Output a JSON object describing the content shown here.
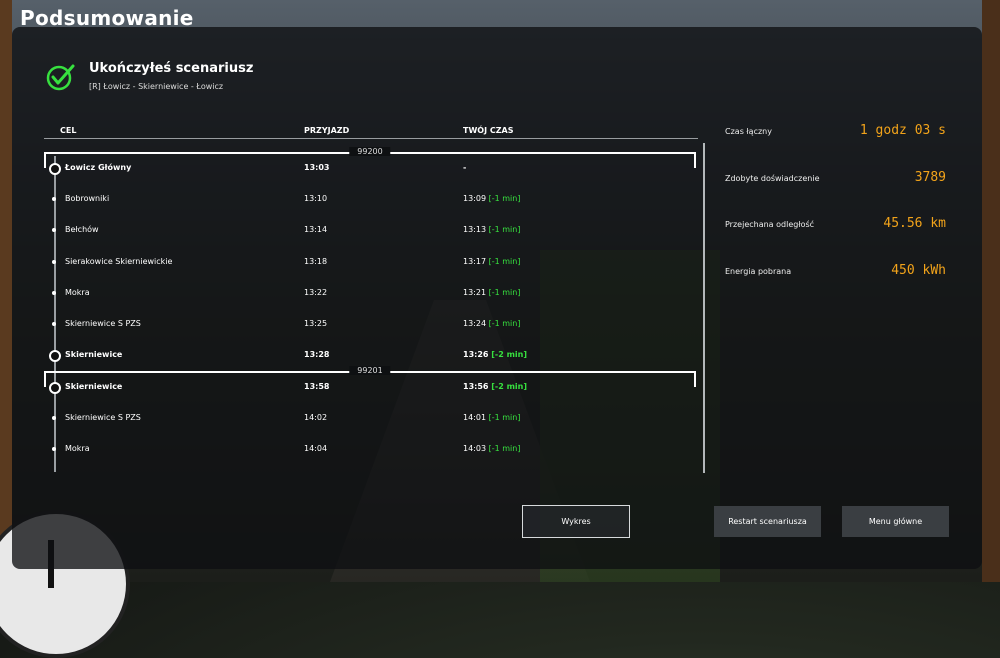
{
  "page_title": "Podsumowanie",
  "header": {
    "title": "Ukończyłeś scenariusz",
    "route": "[R] Łowicz - Skierniewice - Łowicz",
    "check_color": "#37e03f"
  },
  "table": {
    "headers": {
      "target": "CEL",
      "arrival": "PRZYJAZD",
      "your_time": "TWÓJ CZAS"
    },
    "groups": [
      {
        "train_number": "99200",
        "rows": [
          {
            "name": "Łowicz Główny",
            "arrival": "13:03",
            "time": "-",
            "delay": "",
            "major": true
          },
          {
            "name": "Bobrowniki",
            "arrival": "13:10",
            "time": "13:09",
            "delay": "[-1 min]",
            "major": false
          },
          {
            "name": "Bełchów",
            "arrival": "13:14",
            "time": "13:13",
            "delay": "[-1 min]",
            "major": false
          },
          {
            "name": "Sierakowice Skierniewickie",
            "arrival": "13:18",
            "time": "13:17",
            "delay": "[-1 min]",
            "major": false
          },
          {
            "name": "Mokra",
            "arrival": "13:22",
            "time": "13:21",
            "delay": "[-1 min]",
            "major": false
          },
          {
            "name": "Skierniewice S PZS",
            "arrival": "13:25",
            "time": "13:24",
            "delay": "[-1 min]",
            "major": false
          },
          {
            "name": "Skierniewice",
            "arrival": "13:28",
            "time": "13:26",
            "delay": "[-2 min]",
            "major": true
          }
        ]
      },
      {
        "train_number": "99201",
        "rows": [
          {
            "name": "Skierniewice",
            "arrival": "13:58",
            "time": "13:56",
            "delay": "[-2 min]",
            "major": true
          },
          {
            "name": "Skierniewice S PZS",
            "arrival": "14:02",
            "time": "14:01",
            "delay": "[-1 min]",
            "major": false
          },
          {
            "name": "Mokra",
            "arrival": "14:04",
            "time": "14:03",
            "delay": "[-1 min]",
            "major": false
          }
        ]
      }
    ]
  },
  "stats": [
    {
      "label": "Czas łączny",
      "value": "1 godz 03 s"
    },
    {
      "label": "Zdobyte doświadczenie",
      "value": "3789"
    },
    {
      "label": "Przejechana odległość",
      "value": "45.56 km"
    },
    {
      "label": "Energia pobrana",
      "value": "450 kWh"
    }
  ],
  "buttons": {
    "report": "Wykres",
    "restart": "Restart scenariusza",
    "main_menu": "Menu główne"
  },
  "colors": {
    "accent": "#f2a31a",
    "delay": "#37e03f",
    "panel": "#0e1012"
  }
}
